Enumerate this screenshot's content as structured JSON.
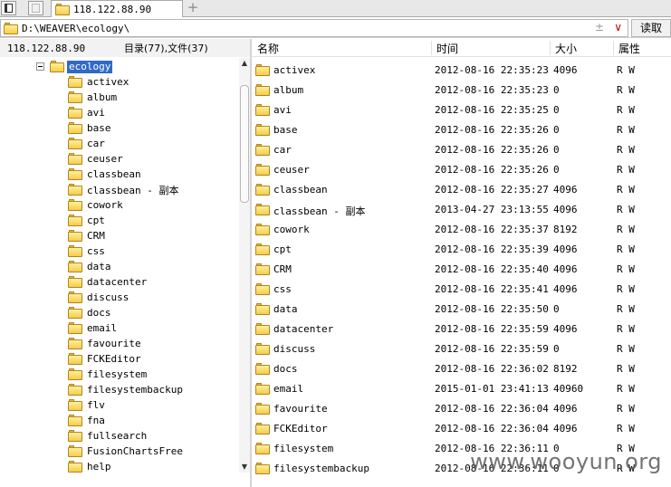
{
  "tabbar": {
    "tab_label": "118.122.88.90",
    "add_label": "+"
  },
  "pathbar": {
    "path": "D:\\WEAVER\\ecology\\",
    "up_glyph": "±",
    "dropdown_glyph": "∨",
    "read_label": "读取"
  },
  "status": {
    "host": "118.122.88.90",
    "counts": "目录(77),文件(37)"
  },
  "tree": {
    "root_label": "ecology",
    "items": [
      "activex",
      "album",
      "avi",
      "base",
      "car",
      "ceuser",
      "classbean",
      "classbean - 副本",
      "cowork",
      "cpt",
      "CRM",
      "css",
      "data",
      "datacenter",
      "discuss",
      "docs",
      "email",
      "favourite",
      "FCKEditor",
      "filesystem",
      "filesystembackup",
      "flv",
      "fna",
      "fullsearch",
      "FusionChartsFree",
      "help"
    ]
  },
  "list": {
    "headers": {
      "name": "名称",
      "time": "时间",
      "size": "大小",
      "attr": "属性"
    },
    "rows": [
      {
        "name": "activex",
        "time": "2012-08-16 22:35:23",
        "size": "4096",
        "attr": "R W"
      },
      {
        "name": "album",
        "time": "2012-08-16 22:35:23",
        "size": "0",
        "attr": "R W"
      },
      {
        "name": "avi",
        "time": "2012-08-16 22:35:25",
        "size": "0",
        "attr": "R W"
      },
      {
        "name": "base",
        "time": "2012-08-16 22:35:26",
        "size": "0",
        "attr": "R W"
      },
      {
        "name": "car",
        "time": "2012-08-16 22:35:26",
        "size": "0",
        "attr": "R W"
      },
      {
        "name": "ceuser",
        "time": "2012-08-16 22:35:26",
        "size": "0",
        "attr": "R W"
      },
      {
        "name": "classbean",
        "time": "2012-08-16 22:35:27",
        "size": "4096",
        "attr": "R W"
      },
      {
        "name": "classbean - 副本",
        "time": "2013-04-27 23:13:55",
        "size": "4096",
        "attr": "R W"
      },
      {
        "name": "cowork",
        "time": "2012-08-16 22:35:37",
        "size": "8192",
        "attr": "R W"
      },
      {
        "name": "cpt",
        "time": "2012-08-16 22:35:39",
        "size": "4096",
        "attr": "R W"
      },
      {
        "name": "CRM",
        "time": "2012-08-16 22:35:40",
        "size": "4096",
        "attr": "R W"
      },
      {
        "name": "css",
        "time": "2012-08-16 22:35:41",
        "size": "4096",
        "attr": "R W"
      },
      {
        "name": "data",
        "time": "2012-08-16 22:35:50",
        "size": "0",
        "attr": "R W"
      },
      {
        "name": "datacenter",
        "time": "2012-08-16 22:35:59",
        "size": "4096",
        "attr": "R W"
      },
      {
        "name": "discuss",
        "time": "2012-08-16 22:35:59",
        "size": "0",
        "attr": "R W"
      },
      {
        "name": "docs",
        "time": "2012-08-16 22:36:02",
        "size": "8192",
        "attr": "R W"
      },
      {
        "name": "email",
        "time": "2015-01-01 23:41:13",
        "size": "40960",
        "attr": "R W"
      },
      {
        "name": "favourite",
        "time": "2012-08-16 22:36:04",
        "size": "4096",
        "attr": "R W"
      },
      {
        "name": "FCKEditor",
        "time": "2012-08-16 22:36:04",
        "size": "4096",
        "attr": "R W"
      },
      {
        "name": "filesystem",
        "time": "2012-08-16 22:36:11",
        "size": "0",
        "attr": "R W"
      },
      {
        "name": "filesystembackup",
        "time": "2012-08-16 22:36:11",
        "size": "0",
        "attr": "R W"
      }
    ]
  },
  "watermark": "www.wooyun.org"
}
